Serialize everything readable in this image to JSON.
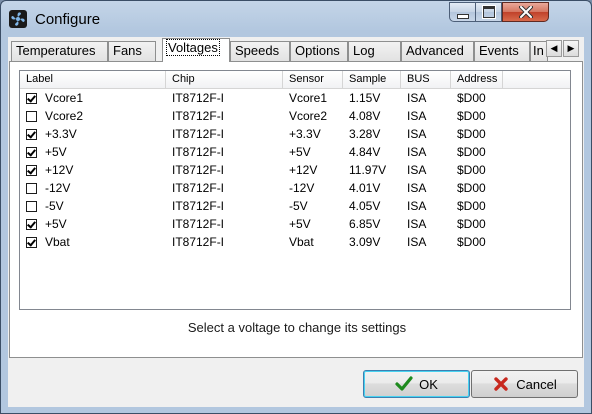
{
  "window": {
    "title": "Configure"
  },
  "tabs": [
    {
      "label": "Temperatures"
    },
    {
      "label": "Fans"
    },
    {
      "label": "Voltages"
    },
    {
      "label": "Speeds"
    },
    {
      "label": "Options"
    },
    {
      "label": "Log"
    },
    {
      "label": "Advanced"
    },
    {
      "label": "Events"
    },
    {
      "label": "In"
    }
  ],
  "active_tab": "Voltages",
  "columns": [
    "Label",
    "Chip",
    "Sensor",
    "Sample",
    "BUS",
    "Address"
  ],
  "rows": [
    {
      "checked": true,
      "label": "Vcore1",
      "chip": "IT8712F-I",
      "sensor": "Vcore1",
      "sample": "1.15V",
      "bus": "ISA",
      "address": "$D00"
    },
    {
      "checked": false,
      "label": "Vcore2",
      "chip": "IT8712F-I",
      "sensor": "Vcore2",
      "sample": "4.08V",
      "bus": "ISA",
      "address": "$D00"
    },
    {
      "checked": true,
      "label": "+3.3V",
      "chip": "IT8712F-I",
      "sensor": "+3.3V",
      "sample": "3.28V",
      "bus": "ISA",
      "address": "$D00"
    },
    {
      "checked": true,
      "label": "+5V",
      "chip": "IT8712F-I",
      "sensor": "+5V",
      "sample": "4.84V",
      "bus": "ISA",
      "address": "$D00"
    },
    {
      "checked": true,
      "label": "+12V",
      "chip": "IT8712F-I",
      "sensor": "+12V",
      "sample": "11.97V",
      "bus": "ISA",
      "address": "$D00"
    },
    {
      "checked": false,
      "label": "-12V",
      "chip": "IT8712F-I",
      "sensor": "-12V",
      "sample": "4.01V",
      "bus": "ISA",
      "address": "$D00"
    },
    {
      "checked": false,
      "label": "-5V",
      "chip": "IT8712F-I",
      "sensor": "-5V",
      "sample": "4.05V",
      "bus": "ISA",
      "address": "$D00"
    },
    {
      "checked": true,
      "label": "+5V",
      "chip": "IT8712F-I",
      "sensor": "+5V",
      "sample": "6.85V",
      "bus": "ISA",
      "address": "$D00"
    },
    {
      "checked": true,
      "label": "Vbat",
      "chip": "IT8712F-I",
      "sensor": "Vbat",
      "sample": "3.09V",
      "bus": "ISA",
      "address": "$D00"
    }
  ],
  "hint": "Select a voltage to change its settings",
  "buttons": {
    "ok": "OK",
    "cancel": "Cancel"
  },
  "icons": {
    "app": "fan-icon",
    "ok": "checkmark-icon",
    "cancel": "x-icon",
    "min": "minimize-icon",
    "max": "maximize-icon",
    "close": "close-icon",
    "tab_left": "chevron-left-icon",
    "tab_right": "chevron-right-icon"
  },
  "colors": {
    "ok_check": "#1e8a1e",
    "cancel_x": "#c8281e",
    "close_button": "#c0412a"
  }
}
